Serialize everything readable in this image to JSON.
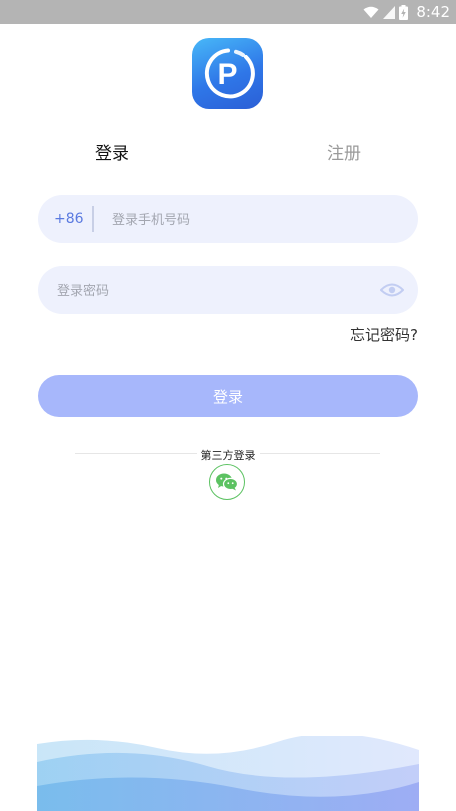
{
  "status_bar": {
    "time": "8:42",
    "icons": [
      "wifi-icon",
      "signal-icon",
      "battery-charging-icon"
    ]
  },
  "app": {
    "logo_icon": "parking-p-icon",
    "logo_letter": "P",
    "brand_color": "#2f77e8"
  },
  "tabs": [
    {
      "label": "登录",
      "active": true
    },
    {
      "label": "注册",
      "active": false
    }
  ],
  "phone_field": {
    "country_code": "+86",
    "value": "",
    "placeholder": "登录手机号码"
  },
  "password_field": {
    "value": "",
    "placeholder": "登录密码",
    "toggle_icon": "eye-icon"
  },
  "forgot_password": "忘记密码?",
  "login_button": "登录",
  "third_party": {
    "label": "第三方登录",
    "providers": [
      {
        "icon": "wechat-icon",
        "color": "#5cc262"
      }
    ]
  },
  "colors": {
    "accent": "#a7b7fb",
    "field_bg": "#eef1fd",
    "country_code": "#5a7ae0"
  }
}
